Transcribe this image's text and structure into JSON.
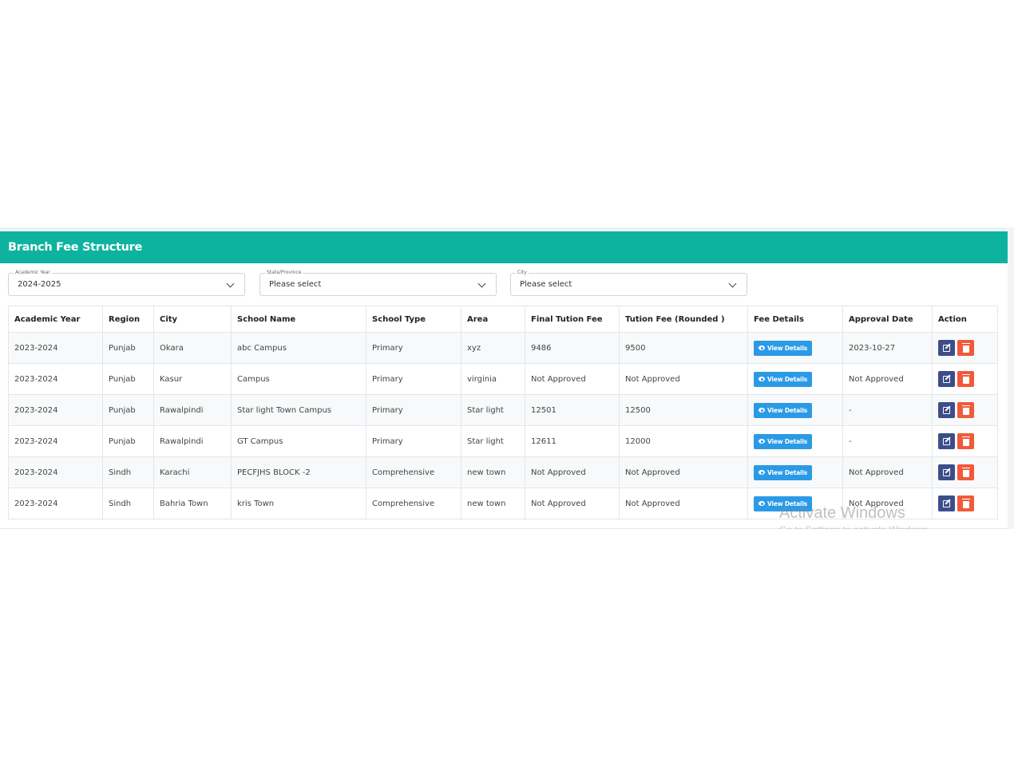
{
  "header": {
    "title": "Branch Fee Structure",
    "accent_color": "#0db39e"
  },
  "filters": [
    {
      "legend": "Academic Year",
      "value": "2024-2025"
    },
    {
      "legend": "State/Province",
      "value": "Please select"
    },
    {
      "legend": "City",
      "value": "Please select"
    }
  ],
  "table": {
    "columns": [
      "Academic Year",
      "Region",
      "City",
      "School Name",
      "School Type",
      "Area",
      "Final Tution Fee",
      "Tution Fee (Rounded )",
      "Fee Details",
      "Approval Date",
      "Action"
    ],
    "view_label": "View Details",
    "rows": [
      [
        "2023-2024",
        "Punjab",
        "Okara",
        "abc Campus",
        "Primary",
        "xyz",
        "9486",
        "9500",
        "2023-10-27"
      ],
      [
        "2023-2024",
        "Punjab",
        "Kasur",
        "Campus",
        "Primary",
        "virginia",
        "Not Approved",
        "Not Approved",
        "Not Approved"
      ],
      [
        "2023-2024",
        "Punjab",
        "Rawalpindi",
        "Star light Town Campus",
        "Primary",
        "Star light",
        "12501",
        "12500",
        "-"
      ],
      [
        "2023-2024",
        "Punjab",
        "Rawalpindi",
        "GT Campus",
        "Primary",
        "Star light",
        "12611",
        "12000",
        "-"
      ],
      [
        "2023-2024",
        "Sindh",
        "Karachi",
        "PECFJHS BLOCK -2",
        "Comprehensive",
        "new town",
        "Not Approved",
        "Not Approved",
        "Not Approved"
      ],
      [
        "2023-2024",
        "Sindh",
        "Bahria Town",
        "kris Town",
        "Comprehensive",
        "new town",
        "Not Approved",
        "Not Approved",
        "Not Approved"
      ]
    ]
  },
  "watermark": {
    "title": "Activate Windows",
    "subtitle": "Go to Settings to activate Windows."
  }
}
